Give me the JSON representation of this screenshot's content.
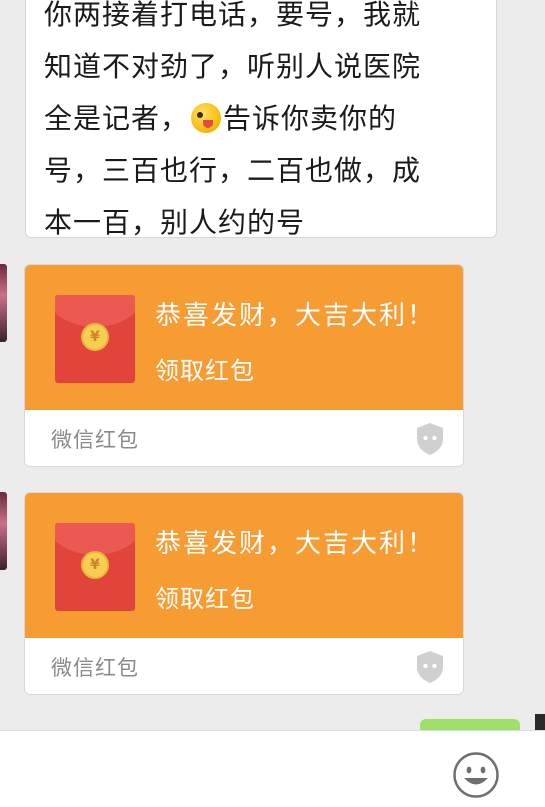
{
  "message": {
    "lines": [
      "你两接着打电话，要号，我就",
      "知道不对劲了，听别人说医院",
      "全是记者，",
      "告诉你卖你的",
      "号，三百也行，二百也做，成",
      "本一百，别人约的号"
    ],
    "emoji": "tongue-wink-emoji"
  },
  "red_packets": [
    {
      "greeting": "恭喜发财，大吉大利！",
      "action": "领取红包",
      "brand": "微信红包",
      "coin_symbol": "¥"
    },
    {
      "greeting": "恭喜发财，大吉大利！",
      "action": "领取红包",
      "brand": "微信红包",
      "coin_symbol": "¥"
    }
  ],
  "colors": {
    "packet_orange": "#f79b33",
    "envelope_red": "#e0443b",
    "coin_gold": "#f6cf52",
    "chat_background": "#ececec",
    "sent_bubble_green": "#9fe06b"
  },
  "input_bar": {
    "emoji_button": "smiley-face-icon"
  }
}
